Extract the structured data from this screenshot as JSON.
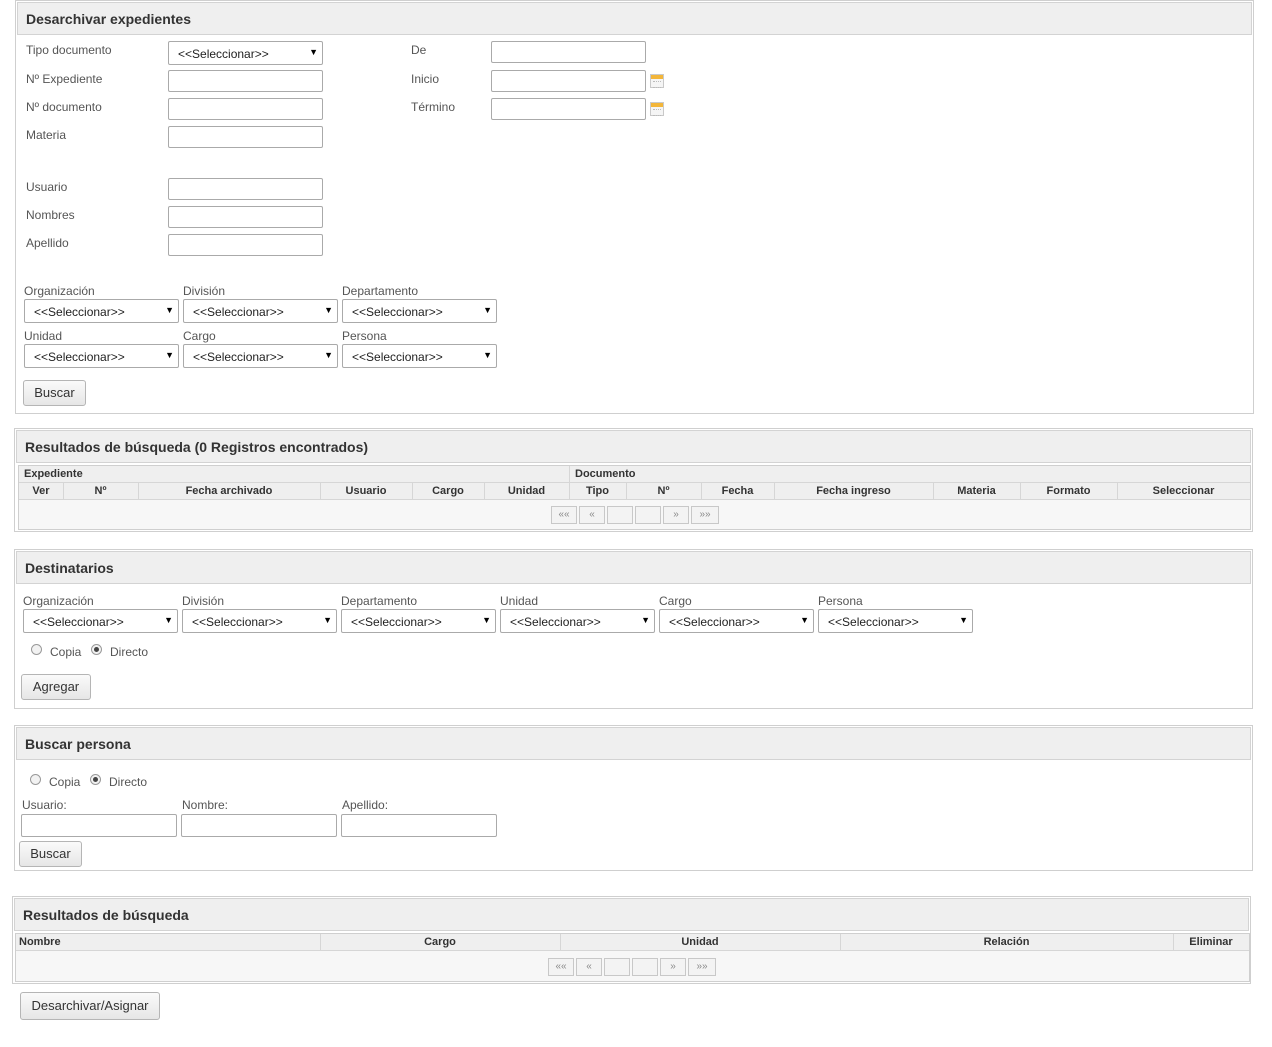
{
  "colors": {
    "panel_header_bg": "#efefef",
    "border": "#cfcfcf",
    "calendar_accent": "#f3b63a"
  },
  "desarchivar": {
    "title": "Desarchivar expedientes",
    "labels": {
      "tipo_documento": "Tipo documento",
      "n_expediente": "Nº Expediente",
      "n_documento": "Nº documento",
      "materia": "Materia",
      "de": "De",
      "inicio": "Inicio",
      "termino": "Término",
      "usuario": "Usuario",
      "nombres": "Nombres",
      "apellido": "Apellido",
      "organizacion": "Organización",
      "division": "División",
      "departamento": "Departamento",
      "unidad": "Unidad",
      "cargo": "Cargo",
      "persona": "Persona"
    },
    "select_default": "<<Seleccionar>>",
    "buscar_label": "Buscar"
  },
  "resultados1": {
    "title": "Resultados de búsqueda (0 Registros encontrados)",
    "group_expediente": "Expediente",
    "group_documento": "Documento",
    "columns": [
      "Ver",
      "Nº",
      "Fecha archivado",
      "Usuario",
      "Cargo",
      "Unidad",
      "Tipo",
      "Nº",
      "Fecha",
      "Fecha ingreso",
      "Materia",
      "Formato",
      "Seleccionar"
    ],
    "pager": [
      "««",
      "«",
      "",
      "",
      "»",
      "»»"
    ]
  },
  "destinatarios": {
    "title": "Destinatarios",
    "labels": [
      "Organización",
      "División",
      "Departamento",
      "Unidad",
      "Cargo",
      "Persona"
    ],
    "select_default": "<<Seleccionar>>",
    "copia": "Copia",
    "directo": "Directo",
    "agregar_label": "Agregar"
  },
  "buscar_persona": {
    "title": "Buscar persona",
    "copia": "Copia",
    "directo": "Directo",
    "usuario": "Usuario:",
    "nombre": "Nombre:",
    "apellido": "Apellido:",
    "buscar_label": "Buscar"
  },
  "resultados2": {
    "title": "Resultados de búsqueda",
    "columns": [
      "Nombre",
      "Cargo",
      "Unidad",
      "Relación",
      "Eliminar"
    ],
    "pager": [
      "««",
      "«",
      "",
      "",
      "»",
      "»»"
    ]
  },
  "footer": {
    "desarchivar_asignar": "Desarchivar/Asignar"
  }
}
